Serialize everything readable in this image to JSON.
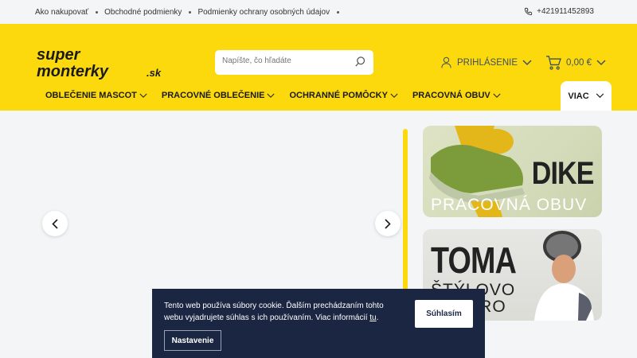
{
  "topbar": {
    "links": [
      "Ako nakupovať",
      "Obchodné podmienky",
      "Podmienky ochrany osobných údajov"
    ],
    "phone": "+421911452893"
  },
  "logo": {
    "line1": "super",
    "line2": "monterky",
    "suffix": ".sk"
  },
  "search": {
    "placeholder": "Napíšte, čo hľadáte"
  },
  "account": {
    "login_label": "PRIHLÁSENIE"
  },
  "cart": {
    "total": "0,00 €"
  },
  "nav": {
    "items": [
      "OBLEČENIE MASCOT",
      "PRACOVNÉ OBLEČENIE",
      "OCHRANNÉ POMÔCKY",
      "PRACOVNÁ OBUV"
    ],
    "more": "VIAC"
  },
  "banners": [
    {
      "title": "DIKE",
      "subtitle": "PRACOVNÁ OBUV"
    },
    {
      "title": "TOMA",
      "subtitle_line1": "ŠTÝLOVO",
      "subtitle_line2": "GASTRO"
    }
  ],
  "cookie": {
    "text_before": "Tento web používa súbory cookie. Ďalším prechádzaním tohto webu vyjadrujete súhlas s ich používaním. Viac informácií ",
    "link": "tu",
    "text_after": ".",
    "accept_label": "Súhlasím",
    "settings_label": "Nastavenie"
  },
  "colors": {
    "brand_yellow": "#fcd90c",
    "cookie_bg": "#1b2742",
    "nav_text": "#3e5060"
  }
}
